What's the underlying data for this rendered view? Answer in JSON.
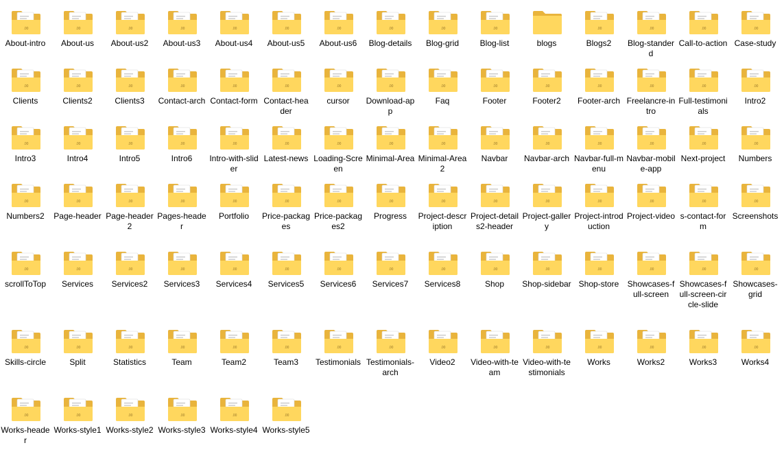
{
  "view": "file-explorer-large-icons",
  "colors": {
    "folder_back": "#E9B43C",
    "folder_front": "#FFD75E",
    "folder_tab": "#F2C14E",
    "paper": "#FFFFFF",
    "label_text": "#000000"
  },
  "icon_names": {
    "folder_with_files": "folder-icon",
    "folder_empty": "folder-empty-icon"
  },
  "folders": [
    {
      "name": "About-intro",
      "has_files": true
    },
    {
      "name": "About-us",
      "has_files": true
    },
    {
      "name": "About-us2",
      "has_files": true
    },
    {
      "name": "About-us3",
      "has_files": true
    },
    {
      "name": "About-us4",
      "has_files": true
    },
    {
      "name": "About-us5",
      "has_files": true
    },
    {
      "name": "About-us6",
      "has_files": true
    },
    {
      "name": "Blog-details",
      "has_files": true
    },
    {
      "name": "Blog-grid",
      "has_files": true
    },
    {
      "name": "Blog-list",
      "has_files": true
    },
    {
      "name": "blogs",
      "has_files": false
    },
    {
      "name": "Blogs2",
      "has_files": true
    },
    {
      "name": "Blog-standerd",
      "has_files": true
    },
    {
      "name": "Call-to-action",
      "has_files": true
    },
    {
      "name": "Case-study",
      "has_files": true
    },
    {
      "name": "Clients",
      "has_files": true
    },
    {
      "name": "Clients2",
      "has_files": true
    },
    {
      "name": "Clients3",
      "has_files": true
    },
    {
      "name": "Contact-arch",
      "has_files": true
    },
    {
      "name": "Contact-form",
      "has_files": true
    },
    {
      "name": "Contact-header",
      "has_files": true
    },
    {
      "name": "cursor",
      "has_files": true
    },
    {
      "name": "Download-app",
      "has_files": true
    },
    {
      "name": "Faq",
      "has_files": true
    },
    {
      "name": "Footer",
      "has_files": true
    },
    {
      "name": "Footer2",
      "has_files": true
    },
    {
      "name": "Footer-arch",
      "has_files": true
    },
    {
      "name": "Freelancre-intro",
      "has_files": true
    },
    {
      "name": "Full-testimonials",
      "has_files": true
    },
    {
      "name": "Intro2",
      "has_files": true
    },
    {
      "name": "Intro3",
      "has_files": true
    },
    {
      "name": "Intro4",
      "has_files": true
    },
    {
      "name": "Intro5",
      "has_files": true
    },
    {
      "name": "Intro6",
      "has_files": true
    },
    {
      "name": "Intro-with-slider",
      "has_files": true
    },
    {
      "name": "Latest-news",
      "has_files": true
    },
    {
      "name": "Loading-Screen",
      "has_files": true
    },
    {
      "name": "Minimal-Area",
      "has_files": true
    },
    {
      "name": "Minimal-Area2",
      "has_files": true
    },
    {
      "name": "Navbar",
      "has_files": true
    },
    {
      "name": "Navbar-arch",
      "has_files": true
    },
    {
      "name": "Navbar-full-menu",
      "has_files": true
    },
    {
      "name": "Navbar-mobile-app",
      "has_files": true
    },
    {
      "name": "Next-project",
      "has_files": true
    },
    {
      "name": "Numbers",
      "has_files": true
    },
    {
      "name": "Numbers2",
      "has_files": true
    },
    {
      "name": "Page-header",
      "has_files": true
    },
    {
      "name": "Page-header2",
      "has_files": true
    },
    {
      "name": "Pages-header",
      "has_files": true
    },
    {
      "name": "Portfolio",
      "has_files": true
    },
    {
      "name": "Price-packages",
      "has_files": true
    },
    {
      "name": "Price-packages2",
      "has_files": true
    },
    {
      "name": "Progress",
      "has_files": true
    },
    {
      "name": "Project-description",
      "has_files": true
    },
    {
      "name": "Project-details2-header",
      "has_files": true
    },
    {
      "name": "Project-gallery",
      "has_files": true
    },
    {
      "name": "Project-introduction",
      "has_files": true
    },
    {
      "name": "Project-video",
      "has_files": true
    },
    {
      "name": "s-contact-form",
      "has_files": true
    },
    {
      "name": "Screenshots",
      "has_files": true
    },
    {
      "name": "scrollToTop",
      "has_files": true
    },
    {
      "name": "Services",
      "has_files": true
    },
    {
      "name": "Services2",
      "has_files": true
    },
    {
      "name": "Services3",
      "has_files": true
    },
    {
      "name": "Services4",
      "has_files": true
    },
    {
      "name": "Services5",
      "has_files": true
    },
    {
      "name": "Services6",
      "has_files": true
    },
    {
      "name": "Services7",
      "has_files": true
    },
    {
      "name": "Services8",
      "has_files": true
    },
    {
      "name": "Shop",
      "has_files": true
    },
    {
      "name": "Shop-sidebar",
      "has_files": true
    },
    {
      "name": "Shop-store",
      "has_files": true
    },
    {
      "name": "Showcases-full-screen",
      "has_files": true
    },
    {
      "name": "Showcases-full-screen-circle-slide",
      "has_files": true
    },
    {
      "name": "Showcases-grid",
      "has_files": true
    },
    {
      "name": "Skills-circle",
      "has_files": true
    },
    {
      "name": "Split",
      "has_files": true
    },
    {
      "name": "Statistics",
      "has_files": true
    },
    {
      "name": "Team",
      "has_files": true
    },
    {
      "name": "Team2",
      "has_files": true
    },
    {
      "name": "Team3",
      "has_files": true
    },
    {
      "name": "Testimonials",
      "has_files": true
    },
    {
      "name": "Testimonials-arch",
      "has_files": true
    },
    {
      "name": "Video2",
      "has_files": true
    },
    {
      "name": "Video-with-team",
      "has_files": true
    },
    {
      "name": "Video-with-testimonials",
      "has_files": true
    },
    {
      "name": "Works",
      "has_files": true
    },
    {
      "name": "Works2",
      "has_files": true
    },
    {
      "name": "Works3",
      "has_files": true
    },
    {
      "name": "Works4",
      "has_files": true
    },
    {
      "name": "Works-header",
      "has_files": true
    },
    {
      "name": "Works-style1",
      "has_files": true
    },
    {
      "name": "Works-style2",
      "has_files": true
    },
    {
      "name": "Works-style3",
      "has_files": true
    },
    {
      "name": "Works-style4",
      "has_files": true
    },
    {
      "name": "Works-style5",
      "has_files": true
    }
  ]
}
